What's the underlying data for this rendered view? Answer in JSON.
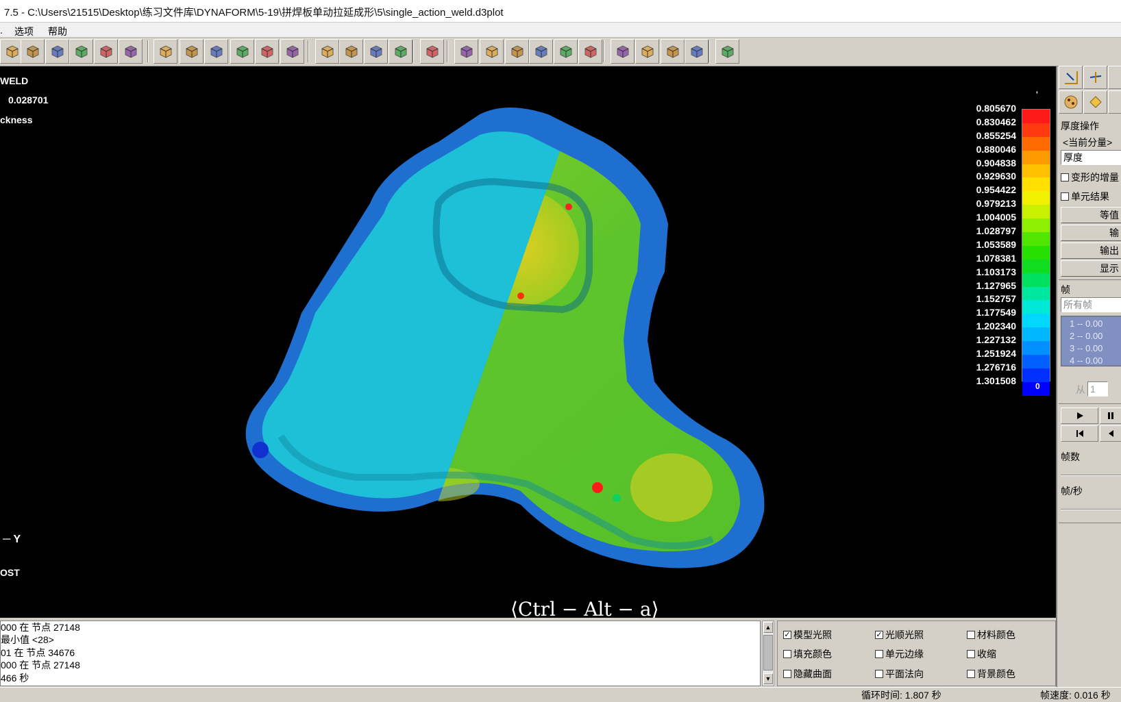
{
  "window": {
    "title": "7.5 - C:\\Users\\21515\\Desktop\\练习文件库\\DYNAFORM\\5-19\\拼焊板单动拉延成形\\5\\single_action_weld.d3plot"
  },
  "menu": {
    "items": [
      "选项",
      "帮助"
    ]
  },
  "toolbar": {
    "icons": [
      "view-iso-icon",
      "view-front-icon",
      "view-top-icon",
      "view-side-icon",
      "view-bottom-icon",
      "view-rotate-icon",
      "rotate-icon",
      "pan-icon",
      "zoom-icon",
      "zoom-window-icon",
      "fit-icon",
      "frame-icon",
      "view-cube-1-icon",
      "view-cube-2-icon",
      "view-cube-3-icon",
      "view-cube-4-icon",
      "brush-icon",
      "node-icon",
      "angle-icon",
      "measure-icon",
      "angle-theta-icon",
      "angle-theta2-icon",
      "distance-icon",
      "section-icon",
      "curve-icon",
      "contour-icon",
      "mesh-icon",
      "graph-icon"
    ]
  },
  "viewport": {
    "label_weld": "WELD",
    "label_value": "0.028701",
    "label_thickness": "ckness",
    "axis_label": "Y",
    "label_post": "OST",
    "watermark": "⟨Ctrl − Alt − a⟩",
    "legend_top_mark": "'",
    "legend_bottom_mark": "0"
  },
  "legend": {
    "values": [
      "0.805670",
      "0.830462",
      "0.855254",
      "0.880046",
      "0.904838",
      "0.929630",
      "0.954422",
      "0.979213",
      "1.004005",
      "1.028797",
      "1.053589",
      "1.078381",
      "1.103173",
      "1.127965",
      "1.152757",
      "1.177549",
      "1.202340",
      "1.227132",
      "1.251924",
      "1.276716",
      "1.301508"
    ],
    "colors": [
      "#ff1a1a",
      "#ff3a10",
      "#ff6a00",
      "#ff9a00",
      "#ffc000",
      "#ffe000",
      "#f0f000",
      "#c8f000",
      "#8cf000",
      "#50e600",
      "#28e000",
      "#10dc20",
      "#00e060",
      "#00e8a0",
      "#00e8d8",
      "#00d8ff",
      "#00b8ff",
      "#0090ff",
      "#0060ff",
      "#0030ff",
      "#0000ff"
    ]
  },
  "right_panel": {
    "section_thickness": "厚度操作",
    "current_component": "<当前分量>",
    "component_value": "厚度",
    "chk_deform": "变形的增量",
    "chk_element": "单元结果",
    "btn_contour": "等值",
    "btn_input": "输",
    "btn_output": "输出",
    "btn_display": "显示",
    "section_frame": "帧",
    "all_frames": "所有帧",
    "frames": [
      "1 -- 0.00",
      "2 -- 0.00",
      "3 -- 0.00",
      "4 -- 0.00"
    ],
    "from_label": "从",
    "from_value": "1",
    "frame_count": "帧数",
    "fps": "帧/秒"
  },
  "console": {
    "lines": [
      "000 在 节点 27148",
      "最小值 <28>",
      "01 在 节点 34676",
      "000 在 节点 27148",
      "466 秒"
    ]
  },
  "options": {
    "model_light": "模型光照",
    "smooth_light": "光顺光照",
    "material_color": "材料颜色",
    "fill_color": "填充颜色",
    "element_edge": "单元边缘",
    "shrink": "收缩",
    "hide_surface": "隐藏曲面",
    "plane_normal": "平面法向",
    "background_color": "背景颜色",
    "model_light_checked": "✓",
    "smooth_light_checked": "✓"
  },
  "status": {
    "cycle_time": "循环时间: 1.807 秒",
    "frame_speed": "帧速度: 0.016 秒"
  }
}
